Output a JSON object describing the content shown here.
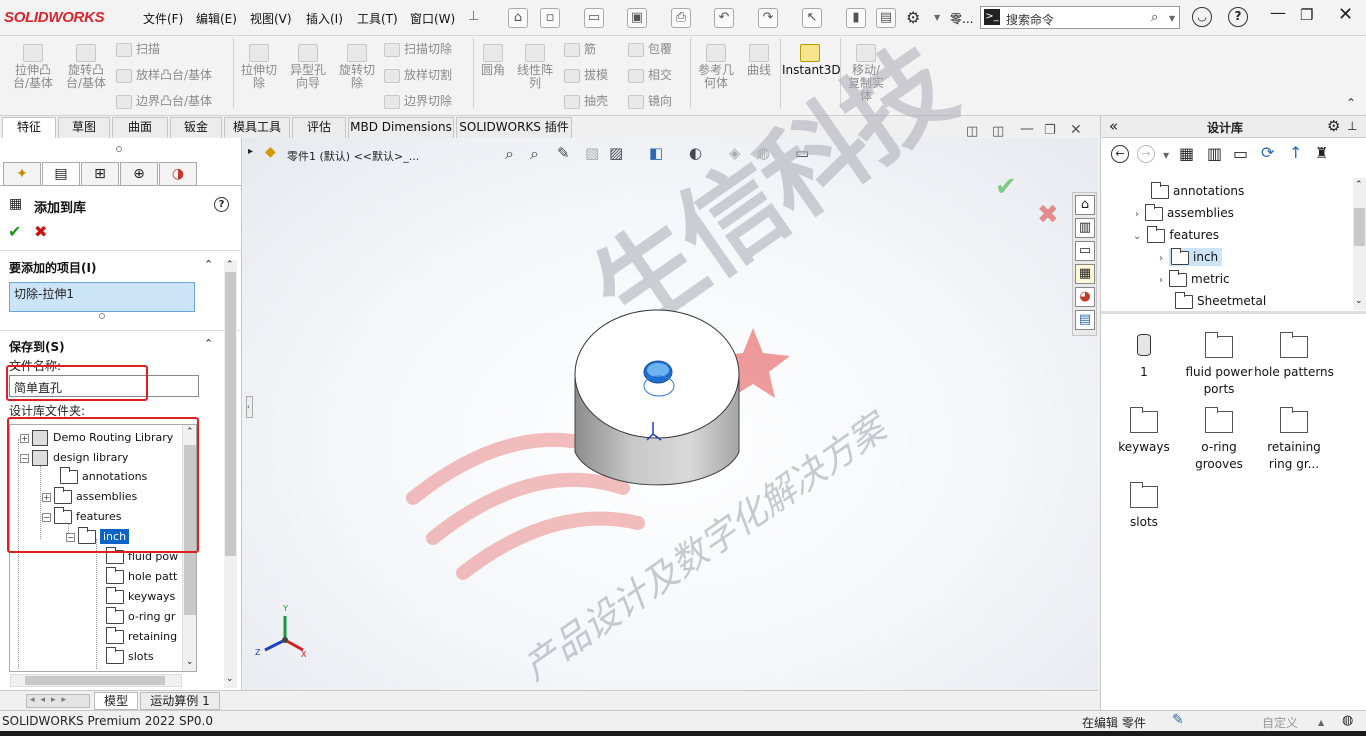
{
  "app": {
    "logo": "SOLIDWORKS",
    "menu": [
      "文件(F)",
      "编辑(E)",
      "视图(V)",
      "插入(I)",
      "工具(T)",
      "窗口(W)"
    ],
    "help_menu": "零...",
    "search_placeholder": "搜索命令"
  },
  "ribbon": {
    "big_buttons": [
      {
        "label": "拉伸凸\n台/基体"
      },
      {
        "label": "旋转凸\n台/基体"
      },
      {
        "label": "拉伸切\n除"
      },
      {
        "label": "异型孔\n向导"
      },
      {
        "label": "旋转切\n除"
      },
      {
        "label": "圆角"
      },
      {
        "label": "线性阵\n列"
      },
      {
        "label": "参考几\n何体"
      },
      {
        "label": "曲线"
      },
      {
        "label": "Instant3D"
      },
      {
        "label": "移动/\n复制实\n体"
      }
    ],
    "small_buttons": [
      "扫描",
      "放样凸台/基体",
      "边界凸台/基体",
      "扫描切除",
      "放样切割",
      "边界切除",
      "筋",
      "拔模",
      "抽壳",
      "包覆",
      "相交",
      "镜向"
    ]
  },
  "tabs": [
    "特征",
    "草图",
    "曲面",
    "钣金",
    "模具工具",
    "评估",
    "MBD Dimensions",
    "SOLIDWORKS 插件"
  ],
  "left_panel": {
    "title": "添加到库",
    "section_items": "要添加的项目(I)",
    "selected_item": "切除-拉伸1",
    "section_save": "保存到(S)",
    "file_name_label": "文件名称:",
    "file_name_value": "简单直孔",
    "folder_label": "设计库文件夹:",
    "tree": [
      {
        "label": "Demo Routing Library",
        "level": 0,
        "expander": "+"
      },
      {
        "label": "design library",
        "level": 0,
        "expander": "-"
      },
      {
        "label": "annotations",
        "level": 1,
        "expander": ""
      },
      {
        "label": "assemblies",
        "level": 1,
        "expander": "+"
      },
      {
        "label": "features",
        "level": 1,
        "expander": "-"
      },
      {
        "label": "inch",
        "level": 2,
        "expander": "-"
      },
      {
        "label": "fluid pow",
        "level": 3,
        "expander": ""
      },
      {
        "label": "hole patt",
        "level": 3,
        "expander": ""
      },
      {
        "label": "keyways",
        "level": 3,
        "expander": ""
      },
      {
        "label": "o-ring gr",
        "level": 3,
        "expander": ""
      },
      {
        "label": "retaining",
        "level": 3,
        "expander": ""
      },
      {
        "label": "slots",
        "level": 3,
        "expander": ""
      }
    ]
  },
  "viewport": {
    "tree_path": "零件1 (默认) <<默认>_...",
    "axis_labels": {
      "x": "X",
      "y": "Y",
      "z": "Z"
    },
    "watermark_main": "生信科技",
    "watermark_sub": "产品设计及数字化解决方案"
  },
  "bottom_tabs": [
    "模型",
    "运动算例 1"
  ],
  "right_panel": {
    "title": "设计库",
    "tree": [
      {
        "label": "annotations",
        "expander": ""
      },
      {
        "label": "assemblies",
        "expander": ">"
      },
      {
        "label": "features",
        "expander": "v"
      },
      {
        "label": "inch",
        "expander": ">",
        "selected": true
      },
      {
        "label": "metric",
        "expander": ">"
      },
      {
        "label": "Sheetmetal",
        "expander": ""
      }
    ],
    "grid": [
      "1",
      "fluid power ports",
      "hole patterns",
      "keyways",
      "o-ring grooves",
      "retaining ring gr...",
      "slots"
    ]
  },
  "status": {
    "left": "SOLIDWORKS Premium 2022 SP0.0",
    "editing": "在编辑 零件",
    "custom": "自定义"
  },
  "colors": {
    "accent": "#0078d7",
    "brand_red": "#d8262e",
    "highlight_box": "#e02020"
  }
}
